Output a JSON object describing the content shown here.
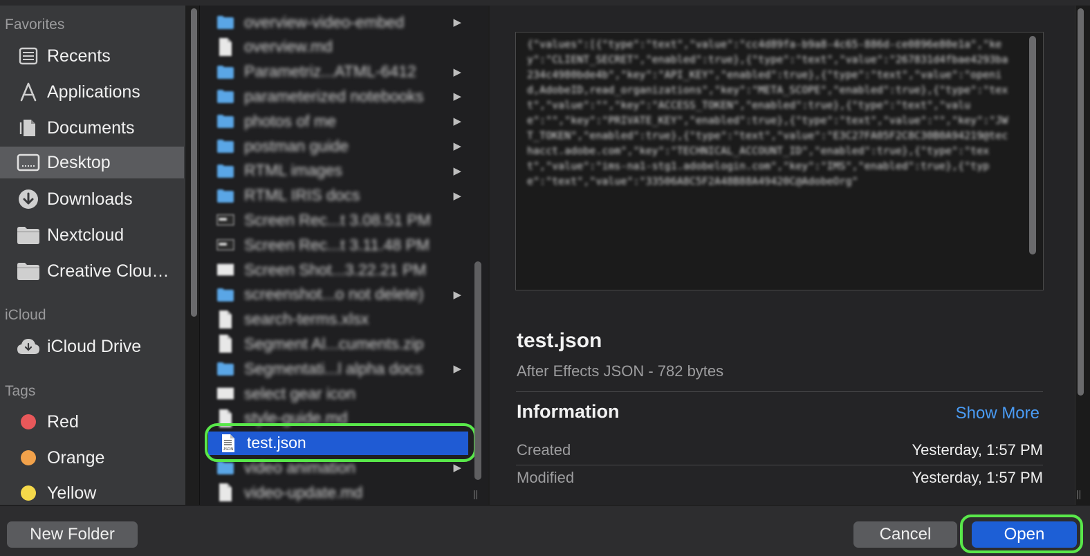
{
  "sidebar": {
    "favorites_heading": "Favorites",
    "favorites": [
      {
        "label": "Recents",
        "icon": "recents-icon"
      },
      {
        "label": "Applications",
        "icon": "applications-icon"
      },
      {
        "label": "Documents",
        "icon": "documents-icon"
      },
      {
        "label": "Desktop",
        "icon": "desktop-icon",
        "selected": true
      },
      {
        "label": "Downloads",
        "icon": "downloads-icon"
      },
      {
        "label": "Nextcloud",
        "icon": "folder-icon"
      },
      {
        "label": "Creative Clou…",
        "icon": "folder-icon"
      }
    ],
    "icloud_heading": "iCloud",
    "icloud": [
      {
        "label": "iCloud Drive",
        "icon": "cloud-icon"
      }
    ],
    "tags_heading": "Tags",
    "tags": [
      {
        "label": "Red",
        "color": "#e8585a"
      },
      {
        "label": "Orange",
        "color": "#f2a24b"
      },
      {
        "label": "Yellow",
        "color": "#f5d94a"
      }
    ]
  },
  "files": [
    {
      "name": "overview-video-embed",
      "type": "folder",
      "arrow": "▶"
    },
    {
      "name": "overview.md",
      "type": "doc"
    },
    {
      "name": "Parametriz...ATML-6412",
      "type": "folder",
      "arrow": "▶"
    },
    {
      "name": "parameterized notebooks",
      "type": "folder",
      "arrow": "▶"
    },
    {
      "name": "photos of me",
      "type": "folder",
      "arrow": "▶"
    },
    {
      "name": "postman guide",
      "type": "folder",
      "arrow": "▶"
    },
    {
      "name": "RTML images",
      "type": "folder",
      "arrow": "▶"
    },
    {
      "name": "RTML IRIS docs",
      "type": "folder",
      "arrow": "▶"
    },
    {
      "name": "Screen Rec...t 3.08.51 PM",
      "type": "video"
    },
    {
      "name": "Screen Rec...t 3.11.48 PM",
      "type": "video"
    },
    {
      "name": "Screen Shot...3.22.21 PM",
      "type": "image"
    },
    {
      "name": "screenshot...o not delete)",
      "type": "folder",
      "arrow": "▶"
    },
    {
      "name": "search-terms.xlsx",
      "type": "doc"
    },
    {
      "name": "Segment Al...cuments.zip",
      "type": "doc"
    },
    {
      "name": "Segmentati...l alpha docs",
      "type": "folder",
      "arrow": "▶"
    },
    {
      "name": "select gear icon",
      "type": "image"
    },
    {
      "name": "style-guide.md",
      "type": "doc"
    },
    {
      "name": "test.json",
      "type": "json",
      "selected": true
    },
    {
      "name": "video animation",
      "type": "folder",
      "arrow": "▶"
    },
    {
      "name": "video-update.md",
      "type": "doc"
    }
  ],
  "preview": {
    "thumbnail_text": "{\"values\":[{\"type\":\"text\",\"value\":\"cc4d89fa-b9a8-4c65-886d-ce0896e80e1a\",\"key\":\"CLIENT_SECRET\",\"enabled\":true},{\"type\":\"text\",\"value\":\"267831d4fbae4293ba234c4980bde4b\",\"key\":\"API_KEY\",\"enabled\":true},{\"type\":\"text\",\"value\":\"openid,AdobeID,read_organizations\",\"key\":\"META_SCOPE\",\"enabled\":true},{\"type\":\"text\",\"value\":\"\",\"key\":\"ACCESS_TOKEN\",\"enabled\":true},{\"type\":\"text\",\"value\":\"\",\"key\":\"PRIVATE_KEY\",\"enabled\":true},{\"type\":\"text\",\"value\":\"\",\"key\":\"JWT_TOKEN\",\"enabled\":true},{\"type\":\"text\",\"value\":\"E3C27FA05F2C8C30B0A94219@techacct.adobe.com\",\"key\":\"TECHNICAL_ACCOUNT_ID\",\"enabled\":true},{\"type\":\"text\",\"value\":\"ims-na1-stg1.adobelogin.com\",\"key\":\"IMS\",\"enabled\":true},{\"type\":\"text\",\"value\":\"33506A8C5F2A48B88A49420C@AdobeOrg\"",
    "file_name": "test.json",
    "kind": "After Effects JSON - 782 bytes",
    "info_heading": "Information",
    "show_more": "Show More",
    "rows": [
      {
        "key": "Created",
        "value": "Yesterday, 1:57 PM"
      },
      {
        "key": "Modified",
        "value": "Yesterday, 1:57 PM"
      }
    ]
  },
  "buttons": {
    "new_folder": "New Folder",
    "cancel": "Cancel",
    "open": "Open"
  },
  "colors": {
    "accent": "#1d5fd6",
    "highlight_ring": "#59e84a",
    "link": "#4a9cf5"
  }
}
